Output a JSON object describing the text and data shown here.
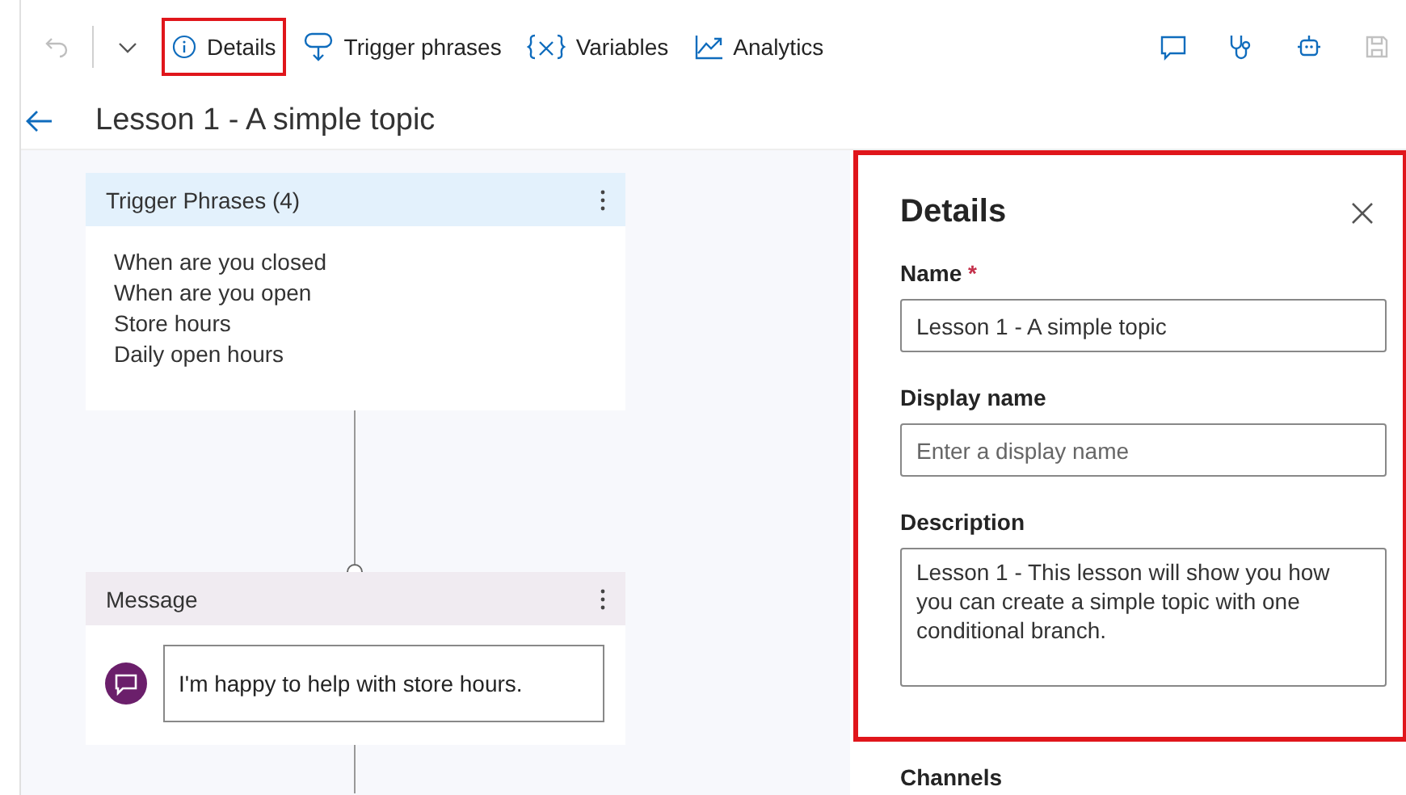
{
  "toolbar": {
    "items": [
      {
        "kind": "undo",
        "highlighted": false,
        "disabled": true
      },
      {
        "kind": "dropdown",
        "highlighted": false,
        "disabled": false
      },
      {
        "kind": "info",
        "label": "Details",
        "highlighted": true,
        "disabled": false
      },
      {
        "kind": "trigger",
        "label": "Trigger phrases",
        "highlighted": false,
        "disabled": false
      },
      {
        "kind": "variables",
        "label": "Variables",
        "highlighted": false,
        "disabled": false
      },
      {
        "kind": "analytics",
        "label": "Analytics",
        "highlighted": false,
        "disabled": false
      }
    ],
    "right_items": [
      {
        "kind": "chat",
        "disabled": false
      },
      {
        "kind": "stethoscope",
        "disabled": false
      },
      {
        "kind": "bot",
        "disabled": false
      },
      {
        "kind": "save",
        "disabled": true
      }
    ]
  },
  "page": {
    "title": "Lesson 1 - A simple topic"
  },
  "canvas": {
    "nodes": [
      {
        "kind": "trigger",
        "title": "Trigger Phrases (4)",
        "phrases": [
          "When are you closed",
          "When are you open",
          "Store hours",
          "Daily open hours"
        ]
      },
      {
        "kind": "message",
        "title": "Message",
        "text": "I'm happy to help with store hours."
      }
    ]
  },
  "details_panel": {
    "title": "Details",
    "highlighted": true,
    "fields": [
      {
        "kind": "input",
        "label": "Name",
        "required_mark": "*",
        "value": "Lesson 1 - A simple topic"
      },
      {
        "kind": "input",
        "label": "Display name",
        "placeholder": "Enter a display name"
      },
      {
        "kind": "textarea",
        "label": "Description",
        "value": "Lesson 1 - This lesson will show you how you can create a simple topic with one conditional branch."
      }
    ],
    "next_section": "Channels"
  }
}
